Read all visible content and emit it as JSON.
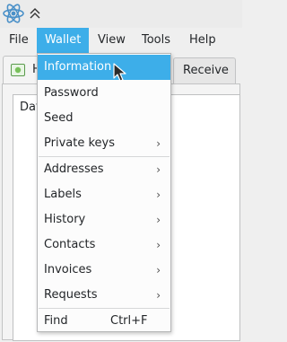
{
  "window": {
    "icon": "electrum-atom-icon",
    "keep_above_icon": "chevron-double-up-icon"
  },
  "menubar": {
    "file": "File",
    "wallet": "Wallet",
    "view": "View",
    "tools": "Tools",
    "help": "Help"
  },
  "tabs": {
    "history_label": "H",
    "history_icon": "history-icon",
    "receive_label": "Receive"
  },
  "list": {
    "date_header": "Dat"
  },
  "wallet_menu": {
    "items": [
      {
        "label": "Information",
        "highlighted": true
      },
      {
        "label": "Password"
      },
      {
        "label": "Seed"
      },
      {
        "label": "Private keys",
        "submenu": true
      },
      {
        "label": "Addresses",
        "submenu": true
      },
      {
        "label": "Labels",
        "submenu": true
      },
      {
        "label": "History",
        "submenu": true
      },
      {
        "label": "Contacts",
        "submenu": true
      },
      {
        "label": "Invoices",
        "submenu": true
      },
      {
        "label": "Requests",
        "submenu": true
      },
      {
        "label": "Find",
        "shortcut": "Ctrl+F"
      }
    ],
    "submenu_arrow": "›"
  },
  "colors": {
    "accent": "#3daee9",
    "window_bg": "#efefef",
    "menu_bg": "#fcfcfc"
  }
}
